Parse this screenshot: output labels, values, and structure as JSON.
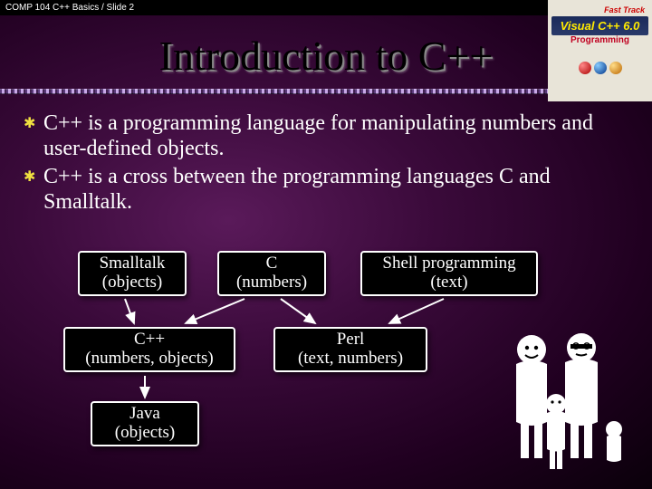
{
  "header": {
    "breadcrumb": "COMP 104 C++ Basics / Slide 2"
  },
  "book": {
    "top": "Fast Track",
    "title": "Visual C++ 6.0",
    "subtitle": "Programming"
  },
  "slide_title": "Introduction to C++",
  "bullets": [
    "C++ is a programming language for manipulating numbers and user-defined objects.",
    "C++ is a cross between the programming languages C and Smalltalk."
  ],
  "boxes": {
    "smalltalk": {
      "line1": "Smalltalk",
      "line2": "(objects)"
    },
    "c": {
      "line1": "C",
      "line2": "(numbers)"
    },
    "shell": {
      "line1": "Shell programming",
      "line2": "(text)"
    },
    "cpp": {
      "line1": "C++",
      "line2": "(numbers, objects)"
    },
    "perl": {
      "line1": "Perl",
      "line2": "(text, numbers)"
    },
    "java": {
      "line1": "Java",
      "line2": "(objects)"
    }
  }
}
